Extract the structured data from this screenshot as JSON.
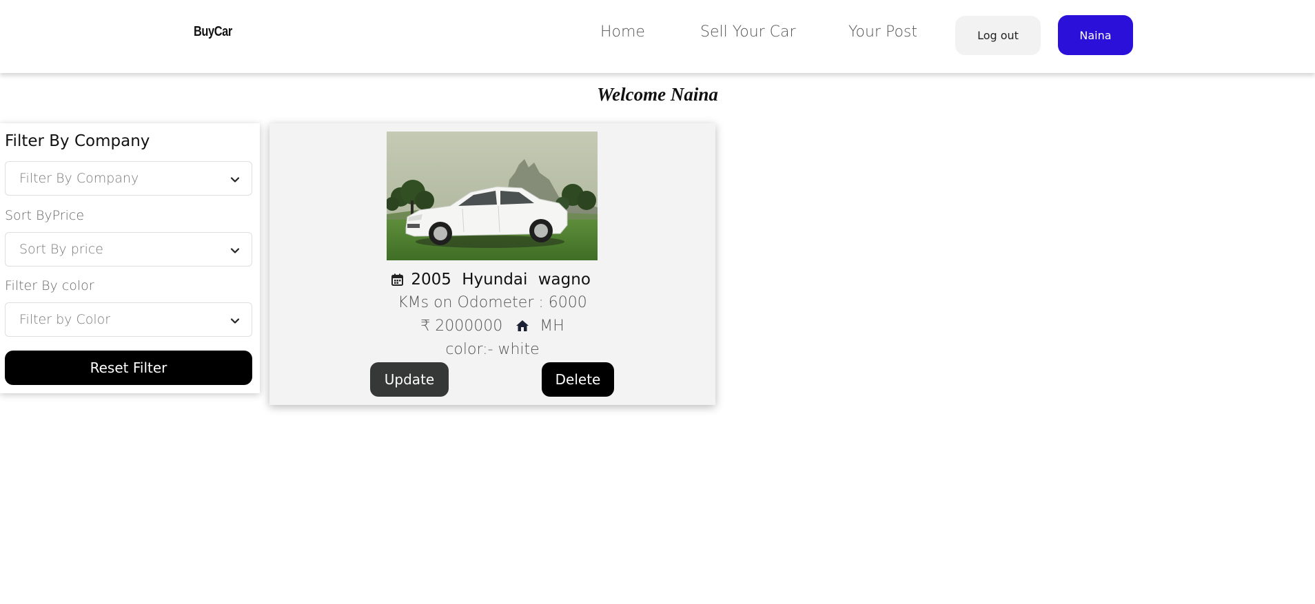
{
  "navbar": {
    "brand": "BuyCar",
    "links": [
      "Home",
      "Sell Your Car",
      "Your Post"
    ],
    "logout_label": "Log out",
    "user_label": "Naina",
    "user_button_color": "#2a10d8"
  },
  "welcome": {
    "text": "Welcome Naina"
  },
  "filters": {
    "company_title": "Filter By Company",
    "company_placeholder": "Filter By Company",
    "price_label": "Sort ByPrice",
    "price_placeholder": "Sort By price",
    "color_label": "Filter By color",
    "color_placeholder": "Filter by Color",
    "reset_label": "Reset Filter"
  },
  "listing": {
    "year": "2005",
    "company": "Hyundai",
    "model": "wagno",
    "odometer": "KMs on Odometer : 6000",
    "price": "₹ 2000000",
    "location": "MH",
    "color": "color:- white",
    "update_label": "Update",
    "delete_label": "Delete",
    "icons": {
      "year": "calendar-icon",
      "location": "home-icon"
    }
  }
}
